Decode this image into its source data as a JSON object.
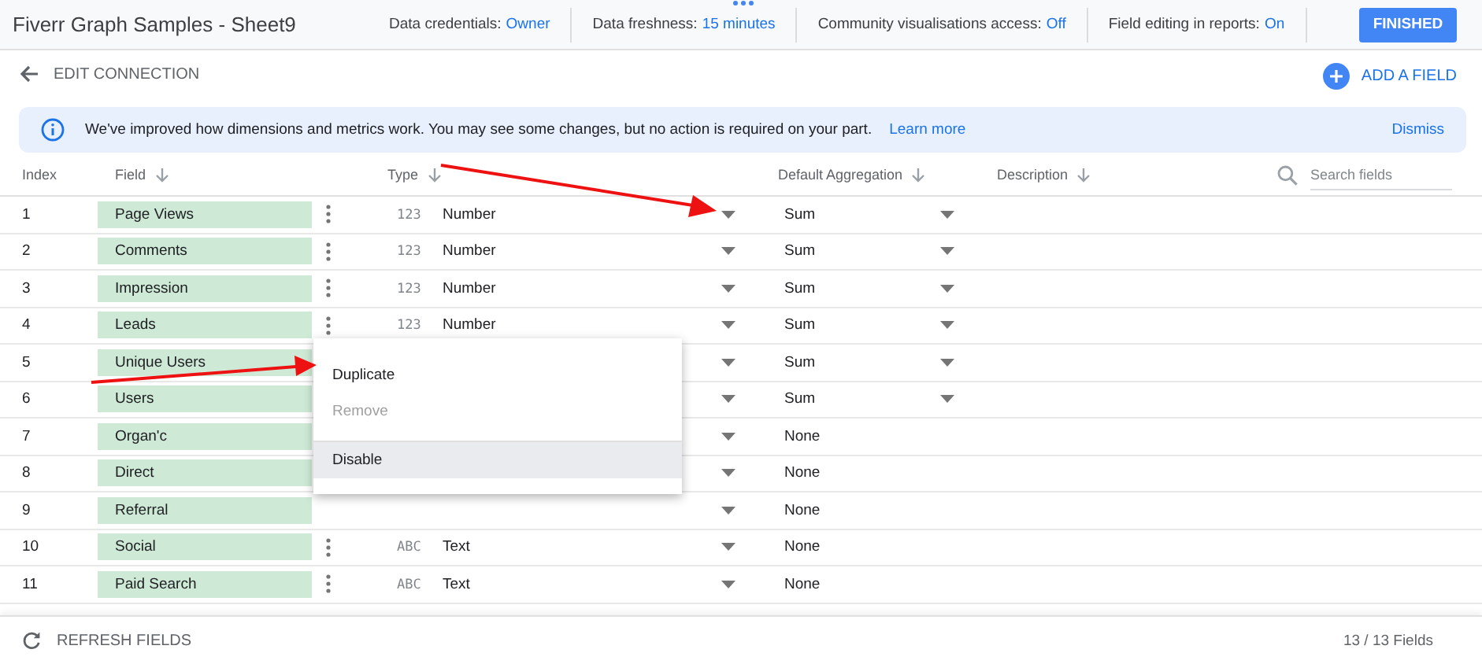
{
  "header": {
    "title": "Fiverr Graph Samples - Sheet9",
    "settings": [
      {
        "label": "Data credentials:",
        "value": "Owner"
      },
      {
        "label": "Data freshness:",
        "value": "15 minutes"
      },
      {
        "label": "Community visualisations access:",
        "value": "Off"
      },
      {
        "label": "Field editing in reports:",
        "value": "On"
      }
    ],
    "finish_button": "FINISHED"
  },
  "toolbar": {
    "back_label": "EDIT CONNECTION",
    "add_field": "ADD A FIELD"
  },
  "banner": {
    "message": "We've improved how dimensions and metrics work. You may see some changes, but no action is required on your part.",
    "link": "Learn more",
    "dismiss": "Dismiss"
  },
  "table": {
    "columns": [
      {
        "label": "Index",
        "sortable": false
      },
      {
        "label": "Field",
        "sortable": true
      },
      {
        "label": "Type",
        "sortable": true
      },
      {
        "label": "Default Aggregation",
        "sortable": true
      },
      {
        "label": "Description",
        "sortable": true
      }
    ],
    "search": {
      "placeholder": "Search fields"
    },
    "rows": [
      {
        "index": "1",
        "field": "Page Views",
        "type_icon": "123",
        "type": "Number",
        "aggregation": "Sum",
        "aggregation_editable": true
      },
      {
        "index": "2",
        "field": "Comments",
        "type_icon": "123",
        "type": "Number",
        "aggregation": "Sum",
        "aggregation_editable": true
      },
      {
        "index": "3",
        "field": "Impression",
        "type_icon": "123",
        "type": "Number",
        "aggregation": "Sum",
        "aggregation_editable": true
      },
      {
        "index": "4",
        "field": "Leads",
        "type_icon": "123",
        "type": "Number",
        "aggregation": "Sum",
        "aggregation_editable": true
      },
      {
        "index": "5",
        "field": "Unique Users",
        "aggregation": "Sum",
        "aggregation_editable": true
      },
      {
        "index": "6",
        "field": "Users",
        "aggregation": "Sum",
        "aggregation_editable": true
      },
      {
        "index": "7",
        "field": "Organ'c",
        "aggregation": "None",
        "aggregation_editable": false
      },
      {
        "index": "8",
        "field": "Direct",
        "aggregation": "None",
        "aggregation_editable": false
      },
      {
        "index": "9",
        "field": "Referral",
        "aggregation": "None",
        "aggregation_editable": false
      },
      {
        "index": "10",
        "field": "Social",
        "type_icon": "ABC",
        "type": "Text",
        "aggregation": "None",
        "aggregation_editable": false
      },
      {
        "index": "11",
        "field": "Paid Search",
        "type_icon": "ABC",
        "type": "Text",
        "aggregation": "None",
        "aggregation_editable": false
      }
    ]
  },
  "context_menu": {
    "items": [
      {
        "label": "Duplicate",
        "disabled": false,
        "highlighted": false,
        "separator_before": false
      },
      {
        "label": "Remove",
        "disabled": true,
        "highlighted": false,
        "separator_before": false
      },
      {
        "label": "Disable",
        "disabled": false,
        "highlighted": true,
        "separator_before": true
      }
    ]
  },
  "footer": {
    "refresh": "REFRESH FIELDS",
    "count": "13 / 13 Fields"
  }
}
